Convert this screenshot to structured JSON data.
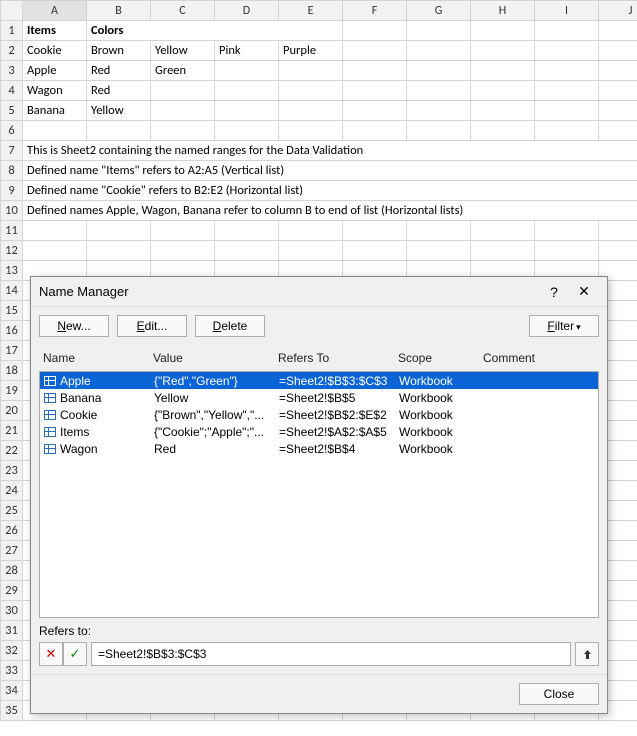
{
  "columns": [
    "A",
    "B",
    "C",
    "D",
    "E",
    "F",
    "G",
    "H",
    "I",
    "J"
  ],
  "cells": {
    "A1": "Items",
    "B1_E1": "Colors",
    "A2": "Cookie",
    "B2": "Brown",
    "C2": "Yellow",
    "D2": "Pink",
    "E2": "Purple",
    "A3": "Apple",
    "B3": "Red",
    "C3": "Green",
    "A4": "Wagon",
    "B4": "Red",
    "A5": "Banana",
    "B5": "Yellow",
    "A7": "This is Sheet2 containing the named ranges for the Data Validation",
    "A8": "Defined name \"Items\" refers to A2:A5 (Vertical list)",
    "A9": "Defined name \"Cookie\" refers to B2:E2 (Horizontal list)",
    "A10": "Defined names Apple, Wagon, Banana refer to column B to end of list (Horizontal lists)"
  },
  "dialog": {
    "title": "Name Manager",
    "help": "?",
    "close_x": "✕",
    "new_btn": "New...",
    "edit_btn": "Edit...",
    "delete_btn": "Delete",
    "filter_btn": "Filter",
    "headers": {
      "name": "Name",
      "value": "Value",
      "refers": "Refers To",
      "scope": "Scope",
      "comment": "Comment"
    },
    "names": [
      {
        "name": "Apple",
        "value": "{\"Red\",\"Green\"}",
        "refers": "=Sheet2!$B$3:$C$3",
        "scope": "Workbook",
        "comment": ""
      },
      {
        "name": "Banana",
        "value": "Yellow",
        "refers": "=Sheet2!$B$5",
        "scope": "Workbook",
        "comment": ""
      },
      {
        "name": "Cookie",
        "value": "{\"Brown\",\"Yellow\",\"...",
        "refers": "=Sheet2!$B$2:$E$2",
        "scope": "Workbook",
        "comment": ""
      },
      {
        "name": "Items",
        "value": "{\"Cookie\";\"Apple\";\"...",
        "refers": "=Sheet2!$A$2:$A$5",
        "scope": "Workbook",
        "comment": ""
      },
      {
        "name": "Wagon",
        "value": "Red",
        "refers": "=Sheet2!$B$4",
        "scope": "Workbook",
        "comment": ""
      }
    ],
    "selected": 0,
    "refers_label": "Refers to:",
    "refers_value": "=Sheet2!$B$3:$C$3",
    "cancel_glyph": "✕",
    "confirm_glyph": "✓",
    "collapse_glyph": "⬆",
    "close_btn": "Close"
  }
}
